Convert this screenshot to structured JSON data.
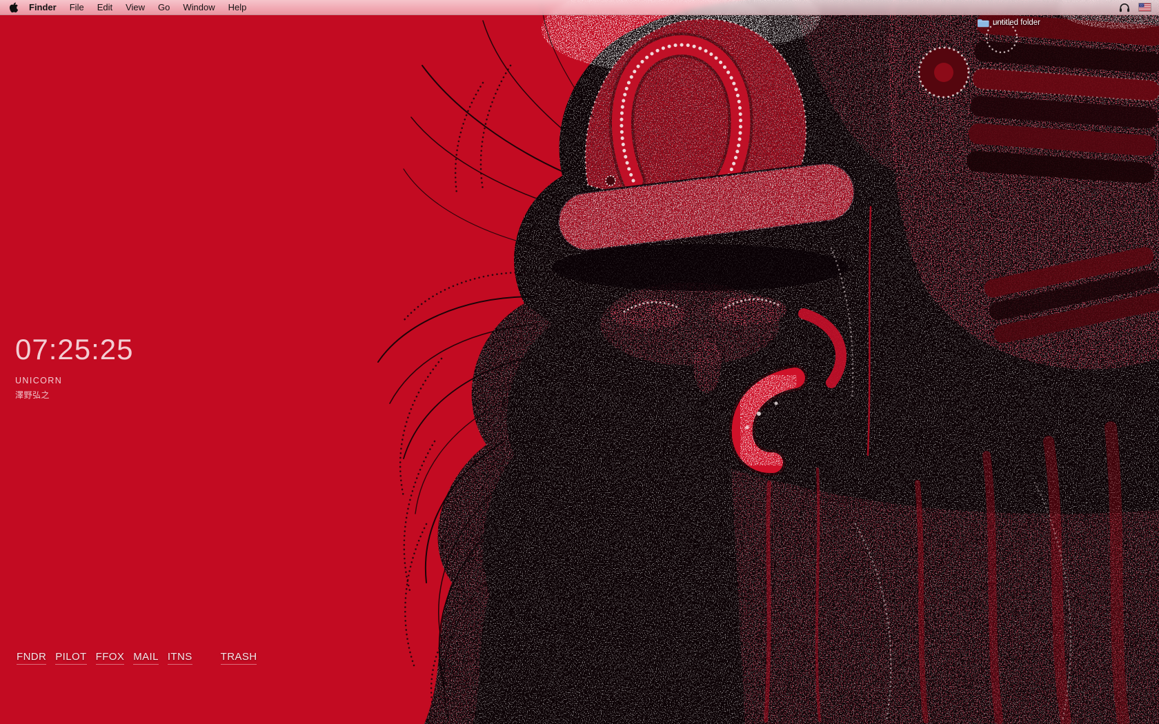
{
  "menu_bar": {
    "menus": [
      "Finder",
      "File",
      "Edit",
      "View",
      "Go",
      "Window",
      "Help"
    ],
    "status_icons": [
      "headphones-icon",
      "us-flag-icon"
    ]
  },
  "desktop_icon": {
    "label": "untitled folder"
  },
  "widget": {
    "time": "07:25:25",
    "song_title": "UNICORN",
    "song_artist": "澤野弘之"
  },
  "dock": {
    "items": [
      "FNDR",
      "PILOT",
      "FFOX",
      "MAIL",
      "ITNS",
      "TRASH"
    ]
  },
  "icons": {
    "apple": "apple-logo-icon",
    "headphones": "headphones-icon",
    "flag": "us-flag-icon",
    "folder": "folder-icon"
  },
  "colors": {
    "background_red": "#c30b22",
    "art_black": "#0d0306",
    "helmet_red": "#ad0c20",
    "menu_bar_tint": "#f8dce0",
    "text_pink": "#f3cdd3"
  }
}
